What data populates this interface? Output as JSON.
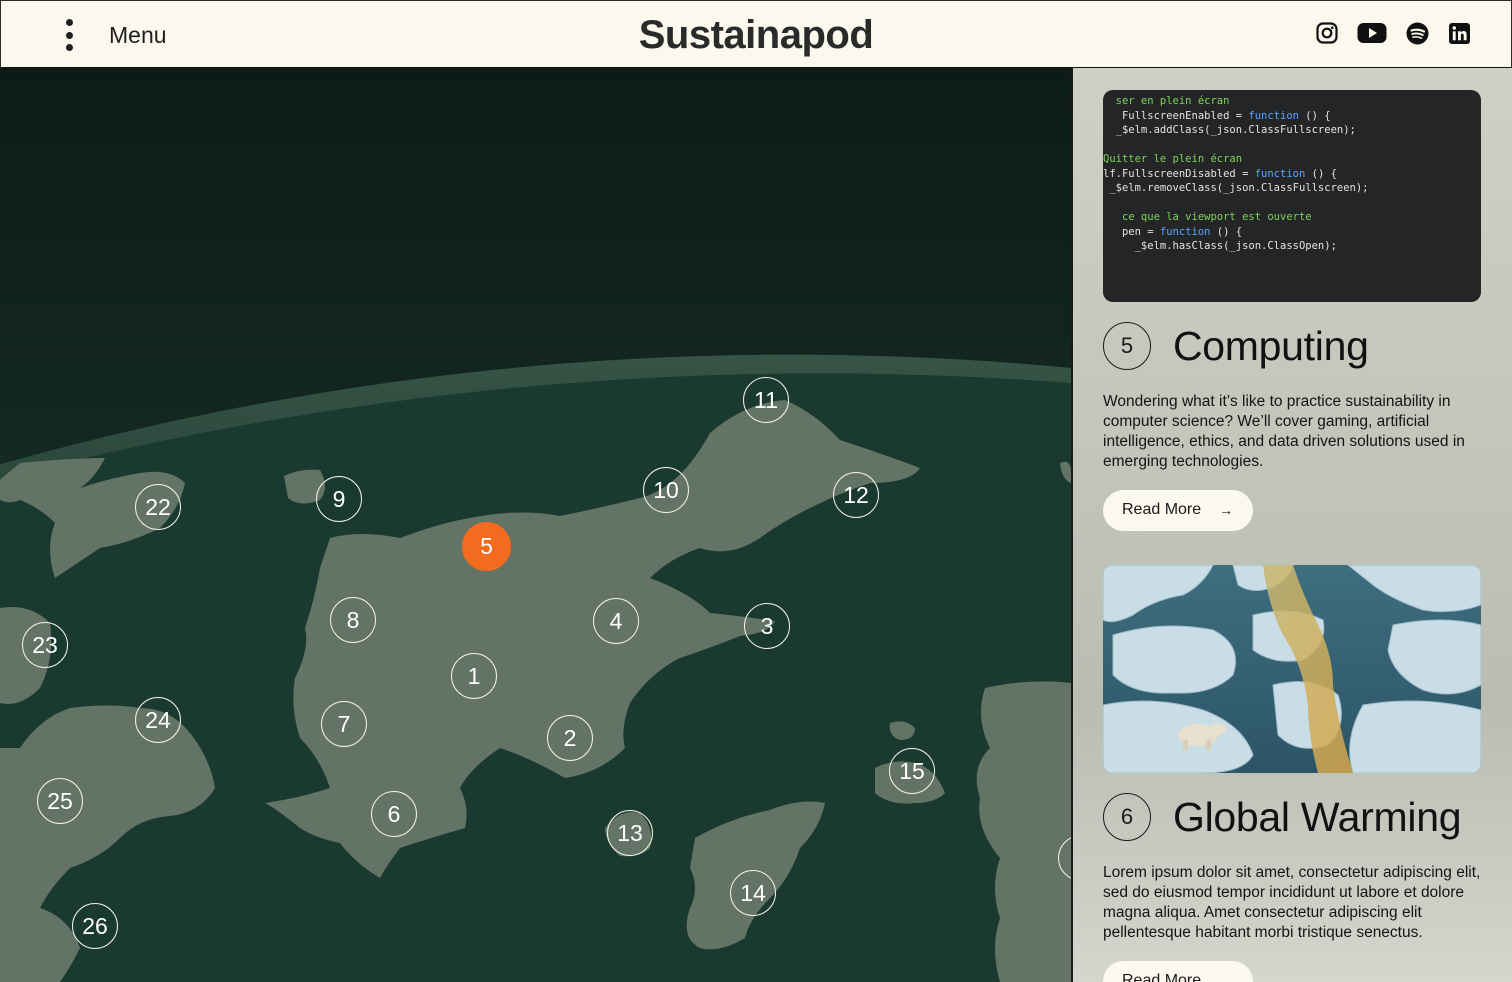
{
  "header": {
    "menu_label": "Menu",
    "brand": "Sustainapod",
    "socials": [
      "instagram-icon",
      "youtube-icon",
      "spotify-icon",
      "linkedin-icon"
    ]
  },
  "map": {
    "markers": [
      "1",
      "2",
      "3",
      "4",
      "5",
      "6",
      "7",
      "8",
      "9",
      "10",
      "11",
      "12",
      "13",
      "14",
      "15",
      "22",
      "23",
      "24",
      "25",
      "26"
    ],
    "active_marker": "5",
    "colors": {
      "ocean": "#1b3a2f",
      "land": "#637466",
      "active": "#f26b1f"
    }
  },
  "panel": {
    "cards": [
      {
        "number": "5",
        "title": "Computing",
        "description": "Wondering what it’s like to practice sustainability in computer science? We’ll cover gaming, artificial intelligence, ethics, and data driven solutions used in emerging technologies.",
        "button": "Read More",
        "image": "code-screenshot-image",
        "code": [
          "  ser en plein écran",
          "   FullscreenEnabled = function () {",
          "  _$elm.addClass(_json.ClassFullscreen);",
          "",
          "Quitter le plein écran",
          "lf.FullscreenDisabled = function () {",
          " _$elm.removeClass(_json.ClassFullscreen);",
          "",
          "   ce que la viewport est ouverte",
          "   pen = function () {",
          "     _$elm.hasClass(_json.ClassOpen);"
        ]
      },
      {
        "number": "6",
        "title": "Global Warming",
        "description": "Lorem ipsum dolor sit amet, consectetur adipiscing elit, sed do eiusmod tempor incididunt ut labore et dolore magna aliqua. Amet consectetur adipiscing elit pellentesque habitant morbi tristique senectus.",
        "button": "Read More",
        "image": "polar-bear-ice-image"
      }
    ]
  }
}
